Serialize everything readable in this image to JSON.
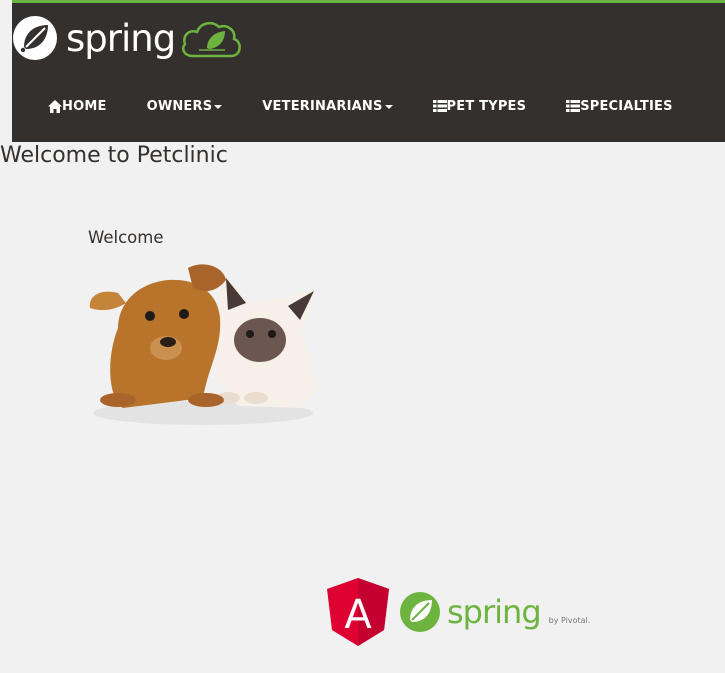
{
  "brand": {
    "wordmark": "spring",
    "badge_icon": "leaf-cloud-badge-icon",
    "logo_icon": "spring-leaf-icon"
  },
  "nav": {
    "home": "HOME",
    "owners": "OWNERS",
    "veterinarians": "VETERINARIANS",
    "pet_types": "PET TYPES",
    "specialties": "SPECIALTIES"
  },
  "page": {
    "title": "Welcome to Petclinic"
  },
  "content": {
    "welcome": "Welcome",
    "image": "puppy-and-kitten-image"
  },
  "footer": {
    "spring_wordmark": "spring",
    "pivotal": "by Pivotal.",
    "angular_letter": "A"
  },
  "colors": {
    "nav_bg": "#34302d",
    "accent": "#6db33f",
    "page_bg": "#f1f1f1",
    "angular_red": "#dd0031"
  }
}
